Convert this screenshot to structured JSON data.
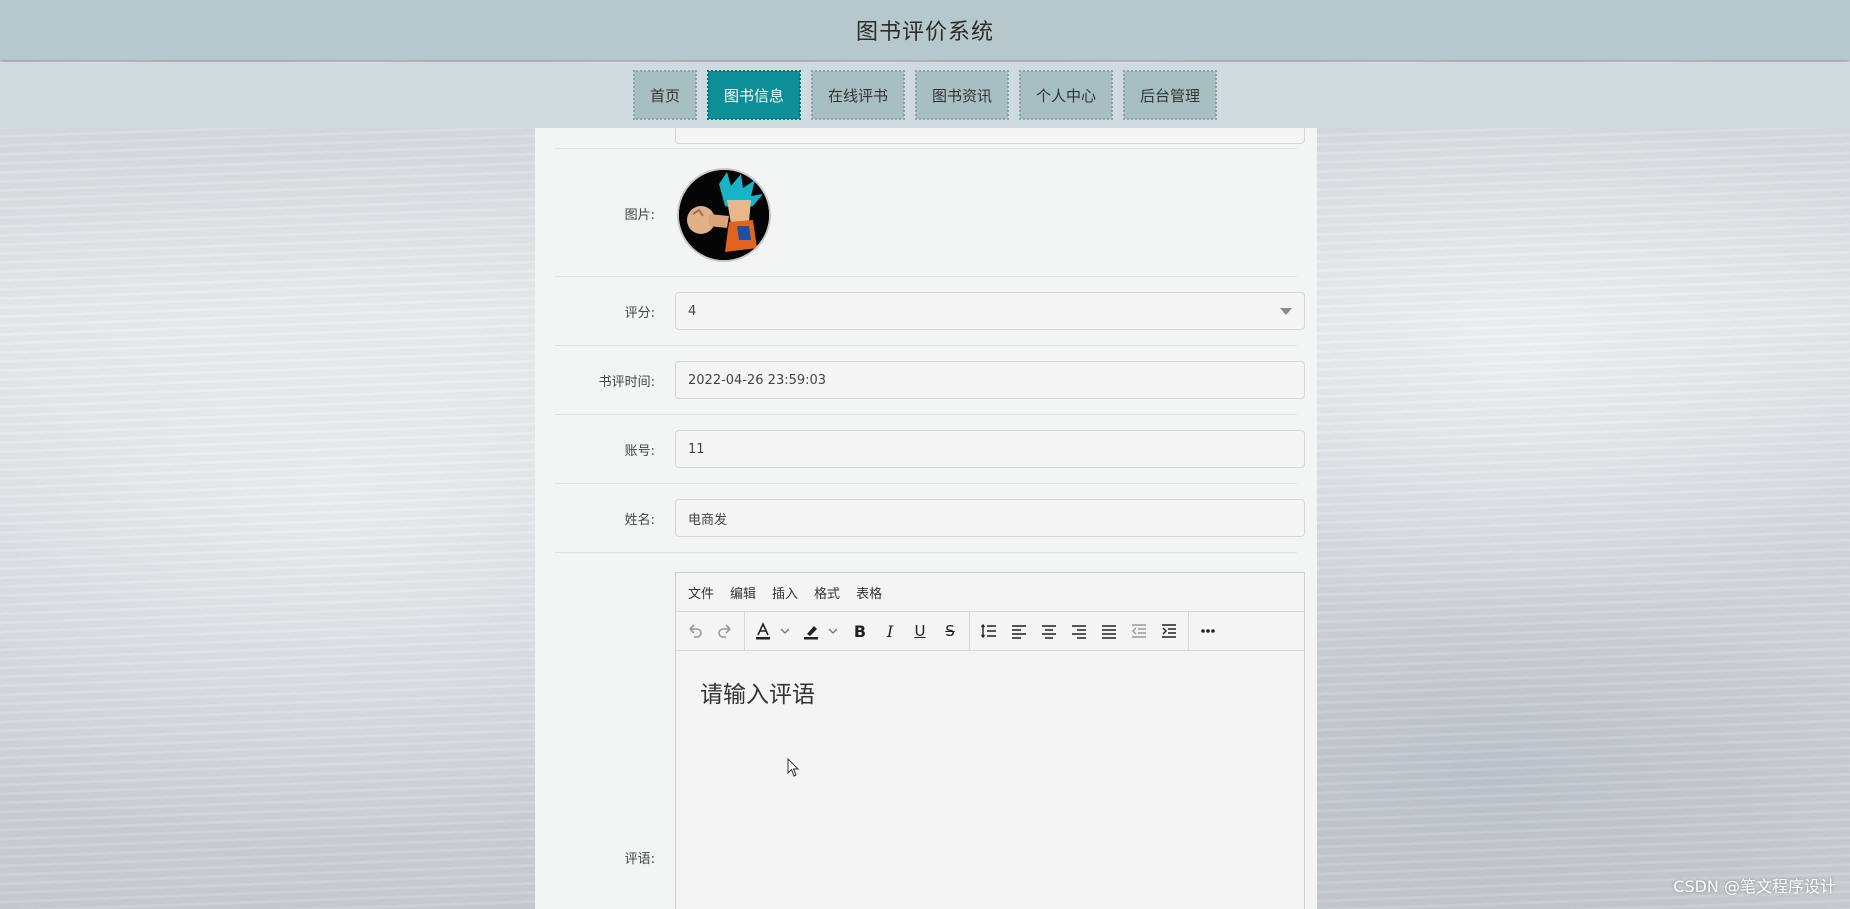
{
  "header": {
    "title": "图书评价系统"
  },
  "nav": {
    "items": [
      {
        "label": "首页"
      },
      {
        "label": "图书信息"
      },
      {
        "label": "在线评书"
      },
      {
        "label": "图书资讯"
      },
      {
        "label": "个人中心"
      },
      {
        "label": "后台管理"
      }
    ],
    "active_index": 1
  },
  "form": {
    "image_label": "图片:",
    "rating_label": "评分:",
    "rating_value": "4",
    "review_time_label": "书评时间:",
    "review_time_value": "2022-04-26 23:59:03",
    "account_label": "账号:",
    "account_value": "11",
    "name_label": "姓名:",
    "name_value": "电商发",
    "comment_label": "评语:"
  },
  "editor": {
    "menus": [
      "文件",
      "编辑",
      "插入",
      "格式",
      "表格"
    ],
    "content": "请输入评语"
  },
  "watermark": "CSDN @笔文程序设计",
  "colors": {
    "header_bg": "#b6c8cb",
    "nav_bg": "#cfdbdf",
    "nav_item_bg": "#a8bfc2",
    "nav_active_bg": "#0d8f98",
    "panel_bg": "#f3f4f4"
  }
}
